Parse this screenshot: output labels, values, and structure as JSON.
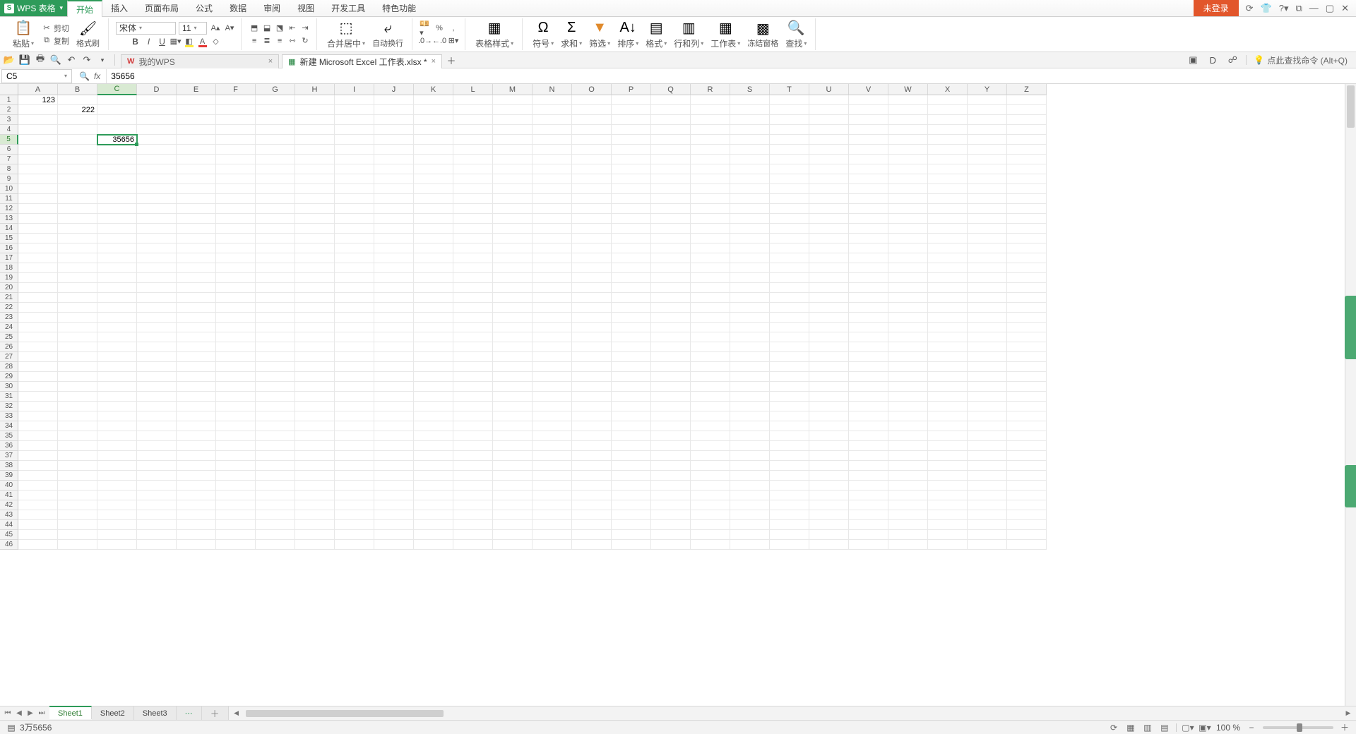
{
  "app": {
    "name": "WPS 表格"
  },
  "menu": [
    "开始",
    "插入",
    "页面布局",
    "公式",
    "数据",
    "审阅",
    "视图",
    "开发工具",
    "特色功能"
  ],
  "menu_active": 0,
  "title_right": {
    "login": "未登录",
    "hint": "点此查找命令 (Alt+Q)"
  },
  "ribbon": {
    "paste": "粘贴",
    "cut": "剪切",
    "copy": "复制",
    "formatpainter": "格式刷",
    "font_name": "宋体",
    "font_size": "11",
    "merge": "合并居中",
    "wrap": "自动换行",
    "currency_group": "",
    "table_style": "表格样式",
    "symbol": "符号",
    "sum": "求和",
    "filter": "筛选",
    "sort": "排序",
    "format": "格式",
    "rowcol": "行和列",
    "worksheet": "工作表",
    "freeze": "冻结窗格",
    "find": "查找"
  },
  "quickbar": {
    "mywps": "我的WPS",
    "doc_tab": "新建 Microsoft Excel 工作表.xlsx *"
  },
  "formula": {
    "cellref": "C5",
    "value": "35656"
  },
  "columns": [
    "A",
    "B",
    "C",
    "D",
    "E",
    "F",
    "G",
    "H",
    "I",
    "J",
    "K",
    "L",
    "M",
    "N",
    "O",
    "P",
    "Q",
    "R",
    "S",
    "T",
    "U",
    "V",
    "W",
    "X",
    "Y",
    "Z"
  ],
  "rows": 46,
  "active": {
    "col": 2,
    "row": 4
  },
  "cell_data": {
    "0": {
      "0": "123"
    },
    "1": {
      "1": "222"
    },
    "4": {
      "2": "35656"
    }
  },
  "sheets": [
    "Sheet1",
    "Sheet2",
    "Sheet3"
  ],
  "sheet_active": 0,
  "status": {
    "text": "3万5656",
    "zoom": "100 %"
  }
}
